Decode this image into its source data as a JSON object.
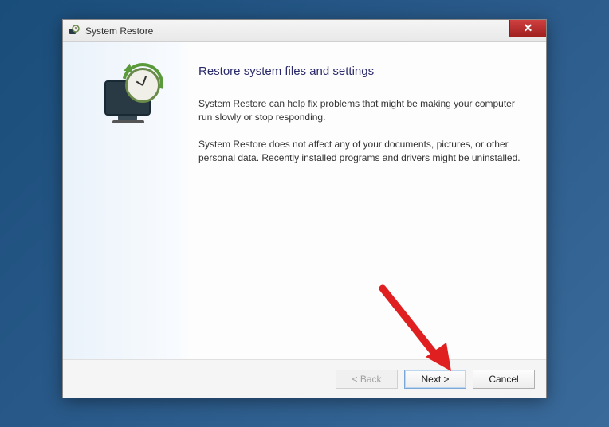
{
  "titlebar": {
    "title": "System Restore"
  },
  "main": {
    "heading": "Restore system files and settings",
    "paragraph1": "System Restore can help fix problems that might be making your computer run slowly or stop responding.",
    "paragraph2": "System Restore does not affect any of your documents, pictures, or other personal data. Recently installed programs and drivers might be uninstalled."
  },
  "buttons": {
    "back": "< Back",
    "next": "Next >",
    "cancel": "Cancel"
  },
  "annotation": {
    "arrow_color": "#e02020"
  }
}
